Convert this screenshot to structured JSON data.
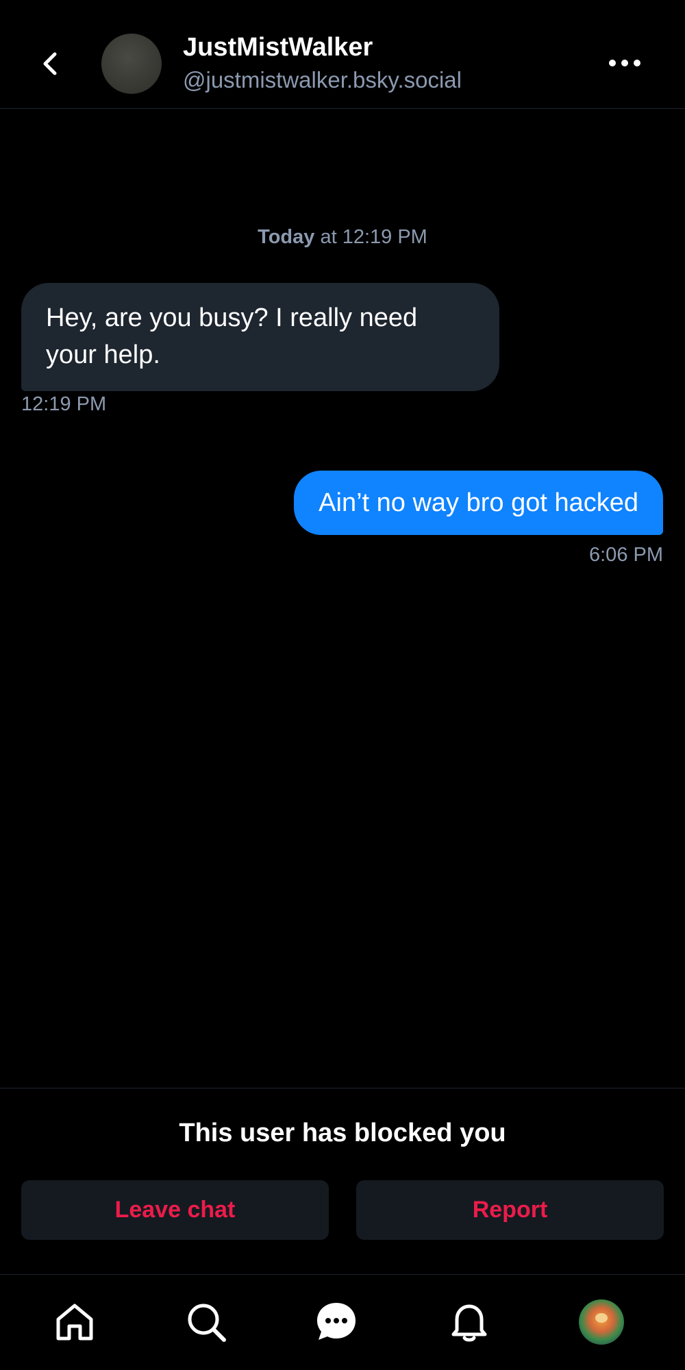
{
  "header": {
    "display_name": "JustMistWalker",
    "handle": "@justmistwalker.bsky.social"
  },
  "conversation": {
    "date_separator_day": "Today",
    "date_separator_time": " at 12:19 PM",
    "messages": [
      {
        "direction": "incoming",
        "text": "Hey, are you busy? I really need your help.",
        "time": "12:19 PM"
      },
      {
        "direction": "outgoing",
        "text": "Ain’t no way bro got hacked",
        "time": "6:06 PM"
      }
    ]
  },
  "blocked_panel": {
    "message": "This user has blocked you",
    "leave_label": "Leave chat",
    "report_label": "Report"
  },
  "tabbar": {
    "items": [
      "home-icon",
      "search-icon",
      "messages-icon",
      "notifications-icon",
      "profile-avatar"
    ],
    "active": "messages"
  },
  "colors": {
    "background": "#000000",
    "incoming_bubble": "#1e2630",
    "outgoing_bubble": "#1083fe",
    "muted_text": "#8c9ab0",
    "danger": "#ec1c4a"
  }
}
